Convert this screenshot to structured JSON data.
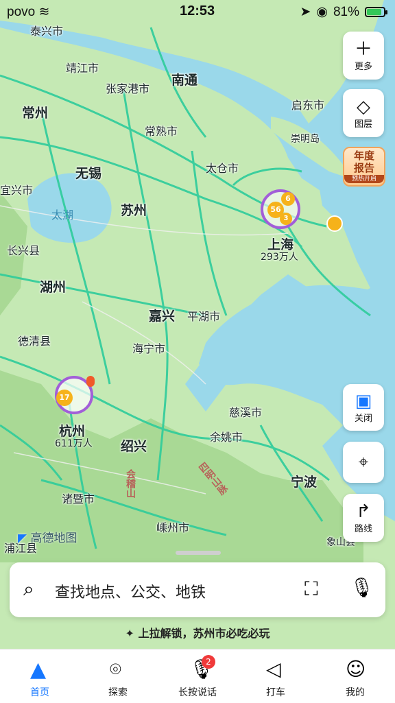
{
  "status_bar": {
    "carrier": "povo",
    "time": "12:53",
    "battery": "81%"
  },
  "map": {
    "cities": {
      "taixing": "泰兴市",
      "jingjiang": "靖江市",
      "nantong": "南通",
      "zhangjiagang": "张家港市",
      "qidong": "启东市",
      "changzhou": "常州",
      "changshu": "常熟市",
      "chongming": "崇明岛",
      "wuxi": "无锡",
      "taicang": "太仓市",
      "yixing": "宜兴市",
      "taihu": "太湖",
      "suzhou": "苏州",
      "changxing": "长兴县",
      "shanghai": "上海",
      "shanghai_pop": "293万人",
      "huzhou": "湖州",
      "jiaxing": "嘉兴",
      "pinghu": "平湖市",
      "deqing": "德清县",
      "haining": "海宁市",
      "cixi": "慈溪市",
      "hangzhou": "杭州",
      "hangzhou_pop": "611万人",
      "yuyao": "余姚市",
      "shaoxing": "绍兴",
      "ningbo": "宁波",
      "zhuji": "诸暨市",
      "shengzhou": "嵊州市",
      "pujiang": "浦江县",
      "xiangshan": "象山县",
      "kuaiji": "会稽山",
      "siming": "四明山脉"
    },
    "markers": {
      "shanghai_count": "56",
      "shanghai_a": "6",
      "shanghai_b": "3",
      "hangzhou_count": "17"
    },
    "logo": "高德地图"
  },
  "side": {
    "more_label": "更多",
    "layers_label": "图层",
    "report_line1": "年度",
    "report_line2": "报告",
    "report_sub": "预热开启",
    "ar_label": "关闭",
    "route_label": "路线"
  },
  "search": {
    "placeholder": "查找地点、公交、地铁"
  },
  "tip": "上拉解锁，苏州市必吃必玩",
  "tabs": [
    {
      "label": "首页"
    },
    {
      "label": "探索"
    },
    {
      "label": "长按说话",
      "badge": "2"
    },
    {
      "label": "打车"
    },
    {
      "label": "我的"
    }
  ],
  "colors": {
    "accent": "#1677ff",
    "land": "#bfe6b2",
    "water": "#9ad8ea",
    "road": "#2ecc9b",
    "badge": "#f03a3a"
  }
}
